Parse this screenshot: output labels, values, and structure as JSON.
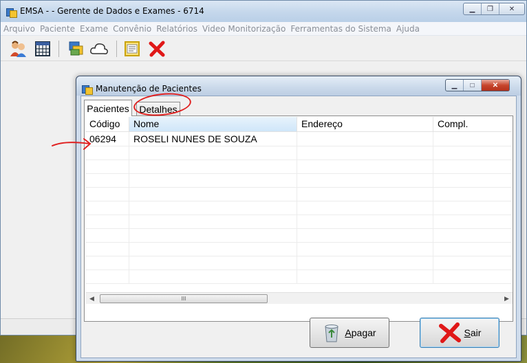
{
  "window": {
    "title": "EMSA -  - Gerente de Dados e Exames - 6714"
  },
  "menu": [
    "Arquivo",
    "Paciente",
    "Exame",
    "Convênio",
    "Relatórios",
    "Video Monitorização",
    "Ferramentas do Sistema",
    "Ajuda"
  ],
  "toolbar": {
    "icons": [
      "patients-icon",
      "calendar-grid-icon",
      "database-icon",
      "cloud-icon",
      "report-icon",
      "close-x-icon"
    ]
  },
  "dialog": {
    "title": "Manutenção de Pacientes",
    "tabs": [
      "Pacientes",
      "Detalhes"
    ],
    "active_tab": "Pacientes",
    "columns": [
      "Código",
      "Nome",
      "Endereço",
      "Compl."
    ],
    "rows": [
      {
        "codigo": "06294",
        "nome": "ROSELI NUNES DE SOUZA",
        "endereco": "",
        "compl": ""
      }
    ],
    "buttons": {
      "apagar": {
        "accel": "A",
        "rest": "pagar"
      },
      "sair": {
        "accel": "S",
        "rest": "air"
      }
    }
  },
  "colors": {
    "titlebar": "#c6d8ec",
    "annotation": "#e02020",
    "selected_header": "#cfe6f9"
  }
}
